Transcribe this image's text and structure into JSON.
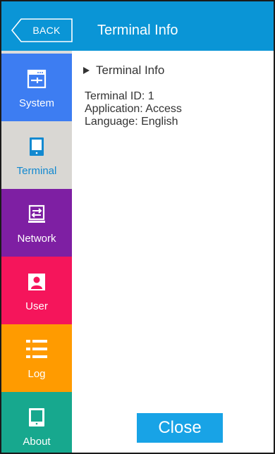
{
  "header": {
    "back_label": "BACK",
    "title": "Terminal Info"
  },
  "sidebar": {
    "items": [
      {
        "label": "System",
        "icon": "system-icon",
        "color": "#3d7df2"
      },
      {
        "label": "Terminal",
        "icon": "terminal-icon",
        "color": "#d9d7d3",
        "selected": true
      },
      {
        "label": "Network",
        "icon": "network-icon",
        "color": "#7e1fa3"
      },
      {
        "label": "User",
        "icon": "user-icon",
        "color": "#f5155b"
      },
      {
        "label": "Log",
        "icon": "log-icon",
        "color": "#ff9b00"
      },
      {
        "label": "About",
        "icon": "about-icon",
        "color": "#17a88e"
      }
    ]
  },
  "main": {
    "section_title": "Terminal Info",
    "terminal_id": "Terminal ID: 1",
    "application": "Application: Access",
    "language": "Language: English",
    "close_label": "Close"
  },
  "colors": {
    "header": "#0a95d6",
    "close_button": "#18a3e6"
  }
}
